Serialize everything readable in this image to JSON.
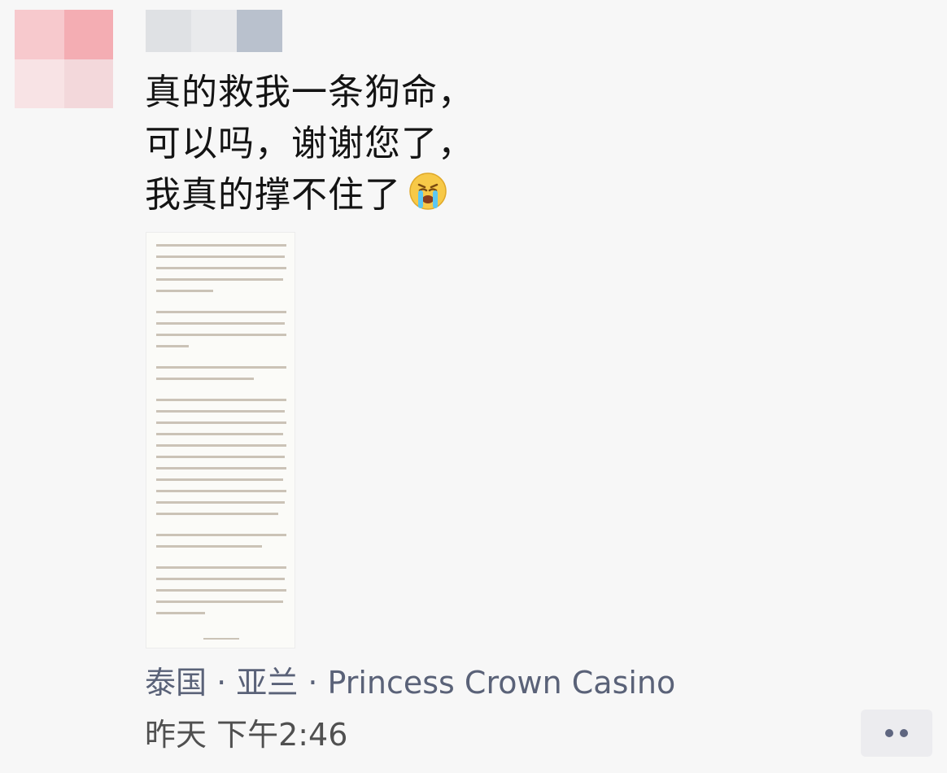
{
  "post": {
    "lines": [
      "真的救我一条狗命，",
      "可以吗，谢谢您了，",
      "我真的撑不住了"
    ],
    "emoji": "crying-face",
    "location": "泰国 · 亚兰 · Princess Crown Casino",
    "time": "昨天 下午2:46"
  },
  "icons": {
    "avatar": "blurred-avatar",
    "more": "more-dots-icon"
  },
  "colors": {
    "text": "#141414",
    "location": "#5a6278",
    "time": "#505050",
    "more_button_bg": "#ececef"
  }
}
